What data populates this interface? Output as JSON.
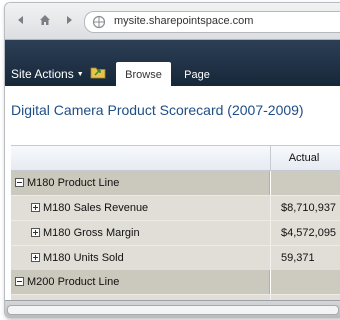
{
  "browser": {
    "url": "mysite.sharepointspace.com"
  },
  "ribbon": {
    "site_actions_label": "Site Actions",
    "tabs": [
      {
        "label": "Browse"
      },
      {
        "label": "Page"
      }
    ]
  },
  "page": {
    "title": "Digital Camera Product Scorecard (2007-2009)"
  },
  "scorecard": {
    "columns": [
      "",
      "Actual"
    ],
    "groups": [
      {
        "label": "M180 Product Line",
        "expanded": true,
        "items": [
          {
            "label": "M180 Sales Revenue",
            "actual": "$8,710,937"
          },
          {
            "label": "M180 Gross Margin",
            "actual": "$4,572,095"
          },
          {
            "label": "M180 Units Sold",
            "actual": "59,371"
          }
        ]
      },
      {
        "label": "M200 Product Line",
        "expanded": true,
        "items": []
      }
    ]
  }
}
